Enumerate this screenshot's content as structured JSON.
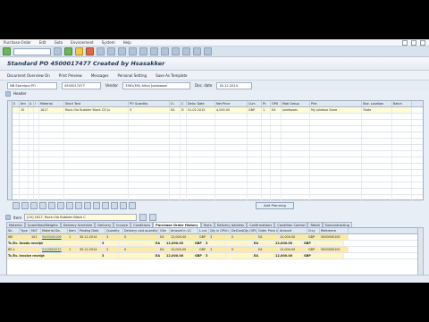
{
  "menu": {
    "items": [
      "Purchase Order",
      "Edit",
      "Goto",
      "Environment",
      "System",
      "Help"
    ]
  },
  "title": "Standard PO 4500017477 Created by Hsasakker",
  "toolbar": {
    "items": [
      "Document Overview On",
      "Print Preview",
      "Messages",
      "Personal Setting",
      "Save As Template"
    ]
  },
  "header": {
    "doc_type": "NB Standard PO",
    "po_number": "4500017477",
    "vendor_label": "Vendor",
    "vendor_value": "3361(M5) Alton Jukebokes",
    "doc_date_label": "Doc. date",
    "doc_date_value": "30.12.2014",
    "section_label": "Header"
  },
  "items_grid": {
    "columns": [
      "S",
      "Itm",
      "A",
      "I",
      "Material",
      "Short Text",
      "PO Quantity",
      "O..",
      "C",
      "Deliv. Date",
      "Net Price",
      "Curr..",
      "Pr.",
      "OPU",
      "Matl Group",
      "Plnt",
      "Stor. Location",
      "Batch"
    ],
    "rows": [
      {
        "itm": "10",
        "material": "1617",
        "short_text": "Rock-Ola Bubbler Black CD Ju",
        "qty": "3",
        "o": "EA",
        "c": "D",
        "deliv": "01.01.2015",
        "price": "4,000.00",
        "curr": "GBP",
        "pr": "1",
        "opu": "EA",
        "mgroup": "Jukeboxes",
        "plnt": "My Jukebox Store",
        "sloc": "Trade"
      }
    ]
  },
  "item_bar": {
    "item_label": "Item",
    "item_value": "[10] 1617, Rock-Ola Bubbler Black C",
    "add_button": "Add Planning"
  },
  "tabs": [
    "Material",
    "Quantities/Weights",
    "Delivery Schedule",
    "Delivery",
    "Invoice",
    "Conditions",
    "Purchase Order History",
    "Texts",
    "Delivery Address",
    "Confirmations",
    "Condition Control",
    "Retail",
    "Subcontracting"
  ],
  "history": {
    "columns": [
      "Sh..",
      "Type",
      "MvT",
      "Material Do..",
      "Item",
      "Posting Date",
      "Quantity",
      "Delivery cost quantity",
      "OUn",
      "Amount in LC",
      "L.cur.",
      "Qty in OPUn",
      "DelCostQty (OPUn)",
      "Order Price Unit",
      "Amount",
      "Crcy",
      "Reference"
    ],
    "rows": [
      {
        "kind": "wu",
        "sh": "WE",
        "type": "",
        "mvt": "101",
        "doc": "5000000106",
        "item": "1",
        "date": "30.12.2014",
        "qty": "3",
        "dcq": "0",
        "oun": "EA",
        "alc": "12,000.00",
        "lcur": "GBP",
        "qopun": "3",
        "dcopun": "0",
        "opu": "EA",
        "amount": "12,000.00",
        "crcy": "GBP",
        "ref": "5000000105"
      },
      {
        "kind": "tr",
        "sh": "Tr./Ev. Goods receipt",
        "type": "",
        "mvt": "",
        "doc": "",
        "item": "",
        "date": "",
        "qty": "3",
        "dcq": "",
        "oun": "EA",
        "alc": "12,000.00",
        "lcur": "GBP",
        "qopun": "3",
        "dcopun": "",
        "opu": "EA",
        "amount": "12,000.00",
        "crcy": "GBP",
        "ref": ""
      },
      {
        "kind": "wu",
        "sh": "RE-L",
        "type": "",
        "mvt": "",
        "doc": "5105600072",
        "item": "1",
        "date": "30.12.2014",
        "qty": "3",
        "dcq": "0",
        "oun": "EA",
        "alc": "12,000.00",
        "lcur": "GBP",
        "qopun": "3",
        "dcopun": "0",
        "opu": "EA",
        "amount": "12,000.00",
        "crcy": "GBP",
        "ref": "5000000102"
      },
      {
        "kind": "tr",
        "sh": "Tr./Ev. Invoice receipt",
        "type": "",
        "mvt": "",
        "doc": "",
        "item": "",
        "date": "",
        "qty": "3",
        "dcq": "",
        "oun": "EA",
        "alc": "12,000.00",
        "lcur": "GBP",
        "qopun": "3",
        "dcopun": "",
        "opu": "EA",
        "amount": "12,000.00",
        "crcy": "GBP",
        "ref": ""
      }
    ]
  }
}
